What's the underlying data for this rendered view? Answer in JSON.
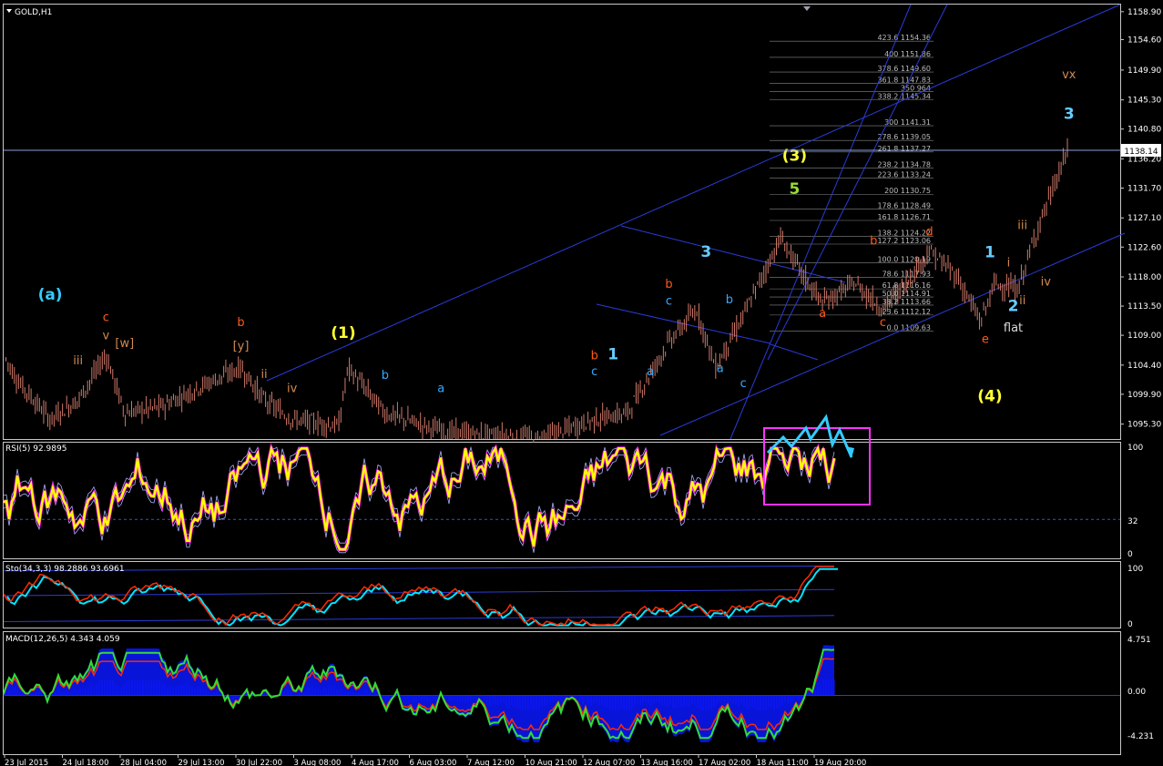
{
  "window": {
    "title": "GOLD,H1"
  },
  "colors": {
    "background": "#000000",
    "grid": "#ffffff",
    "channel": "#2a3bd8",
    "candles": "#d07a6a",
    "rsi": "#ffff00",
    "rsi_extreme": "#ff00ff",
    "stoch_main": "#ff2a00",
    "stoch_signal": "#00e5ff",
    "macd_hist": "#0a18ff",
    "macd_main": "#33dd33",
    "macd_signal": "#ff2a00",
    "highlight_box": "#ff33ff",
    "projection": "#33ccff"
  },
  "chart_data": [
    {
      "type": "line",
      "panel": "price",
      "title": "GOLD,H1",
      "current_price": "1138.14",
      "ylim": [
        1093,
        1160
      ],
      "y_ticks": [
        "1158.90",
        "1154.60",
        "1149.90",
        "1145.30",
        "1140.80",
        "1136.20",
        "1131.70",
        "1127.10",
        "1122.60",
        "1118.00",
        "1113.50",
        "1109.00",
        "1104.40",
        "1099.90",
        "1095.30"
      ],
      "x_tick_labels": [
        "23 Jul 2015",
        "24 Jul 18:00",
        "28 Jul 04:00",
        "29 Jul 13:00",
        "30 Jul 22:00",
        "3 Aug 08:00",
        "4 Aug 17:00",
        "6 Aug 03:00",
        "7 Aug 12:00",
        "10 Aug 21:00",
        "12 Aug 07:00",
        "13 Aug 16:00",
        "17 Aug 02:00",
        "18 Aug 11:00",
        "19 Aug 20:00"
      ],
      "fib_levels": [
        {
          "ratio": "423.6",
          "price": "1154.36"
        },
        {
          "ratio": "400",
          "price": "1151.86"
        },
        {
          "ratio": "378.6",
          "price": "1149.60"
        },
        {
          "ratio": "361.8",
          "price": "1147.83"
        },
        {
          "ratio": "350",
          "price": "964"
        },
        {
          "ratio": "338.2",
          "price": "1145.34"
        },
        {
          "ratio": "300",
          "price": "1141.31"
        },
        {
          "ratio": "278.6",
          "price": "1139.05"
        },
        {
          "ratio": "261.8",
          "price": "1137.27"
        },
        {
          "ratio": "238.2",
          "price": "1134.78"
        },
        {
          "ratio": "223.6",
          "price": "1133.24"
        },
        {
          "ratio": "200",
          "price": "1130.75"
        },
        {
          "ratio": "178.6",
          "price": "1128.49"
        },
        {
          "ratio": "161.8",
          "price": "1126.71"
        },
        {
          "ratio": "138.2",
          "price": "1124.22"
        },
        {
          "ratio": "127.2",
          "price": "1123.06"
        },
        {
          "ratio": "100.0",
          "price": "1120.19"
        },
        {
          "ratio": "78.6",
          "price": "1117.93"
        },
        {
          "ratio": "61.8",
          "price": "1116.16"
        },
        {
          "ratio": "50.0",
          "price": "1114.91"
        },
        {
          "ratio": "38.2",
          "price": "1113.66"
        },
        {
          "ratio": "23.6",
          "price": "1112.12"
        },
        {
          "ratio": "0.0",
          "price": "1109.63"
        }
      ],
      "wave_labels": [
        {
          "text": "(a)",
          "color": "#33ccff",
          "x": 1,
          "y": 1114.5
        },
        {
          "text": "c",
          "color": "#ff5a1a",
          "x": 2.2,
          "y": 1111.2
        },
        {
          "text": "v",
          "color": "#d08a50",
          "x": 2.2,
          "y": 1108.4
        },
        {
          "text": "[w]",
          "color": "#d08a50",
          "x": 2.6,
          "y": 1107.2
        },
        {
          "text": "iii",
          "color": "#d08a50",
          "x": 1.6,
          "y": 1104.5
        },
        {
          "text": "b",
          "color": "#ff5a1a",
          "x": 5.1,
          "y": 1110.4
        },
        {
          "text": "[y]",
          "color": "#d08a50",
          "x": 5.1,
          "y": 1106.8
        },
        {
          "text": "ii",
          "color": "#d08a50",
          "x": 5.6,
          "y": 1102.4
        },
        {
          "text": "iv",
          "color": "#d08a50",
          "x": 6.2,
          "y": 1100.2
        },
        {
          "text": "(1)",
          "color": "#ffff33",
          "x": 7.3,
          "y": 1108.6
        },
        {
          "text": "b",
          "color": "#33aaff",
          "x": 8.2,
          "y": 1102.3
        },
        {
          "text": "a",
          "color": "#33aaff",
          "x": 9.4,
          "y": 1100.2
        },
        {
          "text": "b",
          "color": "#ff5a1a",
          "x": 12.7,
          "y": 1105.3
        },
        {
          "text": "1",
          "color": "#66ccff",
          "x": 13.1,
          "y": 1105.3
        },
        {
          "text": "c",
          "color": "#33aaff",
          "x": 12.7,
          "y": 1102.8
        },
        {
          "text": "a",
          "color": "#33aaff",
          "x": 13.9,
          "y": 1102.8
        },
        {
          "text": "3",
          "color": "#66ccff",
          "x": 15.1,
          "y": 1121.1
        },
        {
          "text": "b",
          "color": "#ff5a1a",
          "x": 14.3,
          "y": 1116.3
        },
        {
          "text": "c",
          "color": "#33aaff",
          "x": 14.3,
          "y": 1113.7
        },
        {
          "text": "b",
          "color": "#33aaff",
          "x": 15.6,
          "y": 1113.9
        },
        {
          "text": "a",
          "color": "#33aaff",
          "x": 15.4,
          "y": 1103.3
        },
        {
          "text": "c",
          "color": "#33aaff",
          "x": 15.9,
          "y": 1101.0
        },
        {
          "text": "(3)",
          "color": "#ffff33",
          "x": 17.0,
          "y": 1135.9
        },
        {
          "text": "5",
          "color": "#99dd33",
          "x": 17.0,
          "y": 1130.8
        },
        {
          "text": "b",
          "color": "#ff5a1a",
          "x": 18.7,
          "y": 1123.0
        },
        {
          "text": "d",
          "color": "#ff5a1a",
          "x": 19.9,
          "y": 1124.4
        },
        {
          "text": "a",
          "color": "#ff5a1a",
          "x": 17.6,
          "y": 1111.8
        },
        {
          "text": "c",
          "color": "#ff5a1a",
          "x": 18.9,
          "y": 1110.4
        },
        {
          "text": "1",
          "color": "#66ccff",
          "x": 21.2,
          "y": 1121.0
        },
        {
          "text": "i",
          "color": "#d08a50",
          "x": 21.6,
          "y": 1119.6
        },
        {
          "text": "iii",
          "color": "#d08a50",
          "x": 21.9,
          "y": 1125.4
        },
        {
          "text": "iv",
          "color": "#d08a50",
          "x": 22.4,
          "y": 1116.7
        },
        {
          "text": "ii",
          "color": "#d08a50",
          "x": 21.9,
          "y": 1113.8
        },
        {
          "text": "2",
          "color": "#66ccff",
          "x": 21.7,
          "y": 1112.7
        },
        {
          "text": "flat",
          "color": "#dddddd",
          "x": 21.7,
          "y": 1109.6
        },
        {
          "text": "e",
          "color": "#ff5a1a",
          "x": 21.1,
          "y": 1107.8
        },
        {
          "text": "(4)",
          "color": "#ffff33",
          "x": 21.2,
          "y": 1098.8
        },
        {
          "text": "3",
          "color": "#66ccff",
          "x": 22.9,
          "y": 1142.4
        },
        {
          "text": "vx",
          "color": "#d08a50",
          "x": 22.9,
          "y": 1148.6
        }
      ]
    },
    {
      "type": "line",
      "panel": "rsi",
      "title": "RSI(5) 92.9895",
      "ylim": [
        0,
        100
      ],
      "y_ticks": [
        "100",
        "32",
        "0"
      ],
      "level": 32
    },
    {
      "type": "line",
      "panel": "stochastic",
      "title": "Sto(34,3,3) 98.2886 93.6961",
      "ylim": [
        0,
        100
      ],
      "y_ticks": [
        "100",
        "0"
      ]
    },
    {
      "type": "bar",
      "panel": "macd",
      "title": "MACD(12,26,5) 4.343 4.059",
      "ylim": [
        -4.231,
        4.751
      ],
      "y_ticks": [
        "4.751",
        "0.00",
        "-4.231"
      ]
    }
  ]
}
